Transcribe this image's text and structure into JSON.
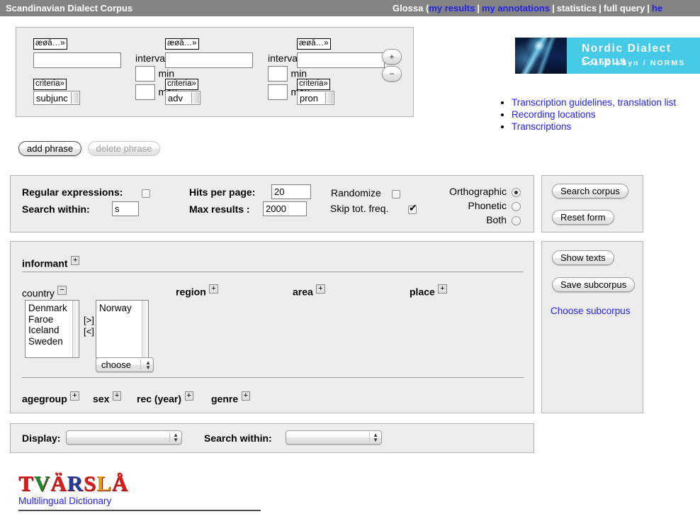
{
  "header": {
    "brand": "Scandinavian Dialect Corpus",
    "app_prefix": "Glossa (",
    "links": [
      {
        "label": "my results",
        "type": "link"
      },
      {
        "label": "my annotations",
        "type": "link"
      },
      {
        "label": "statistics",
        "type": "plain"
      },
      {
        "label": "full query",
        "type": "plain"
      },
      {
        "label": "he",
        "type": "link"
      }
    ],
    "separator": "|"
  },
  "query_builder": {
    "tokens": [
      {
        "special_chars_label": "æøå…»",
        "word_value": "",
        "criteria_label": "criteria»",
        "pos_value": "subjunc"
      },
      {
        "special_chars_label": "æøå…»",
        "word_value": "",
        "criteria_label": "criteria»",
        "pos_value": "adv"
      },
      {
        "special_chars_label": "æøå…»",
        "word_value": "",
        "criteria_label": "criteria»",
        "pos_value": "pron"
      }
    ],
    "intervals": [
      {
        "label": "interval:",
        "min_label": "min",
        "max_label": "max",
        "min_value": "",
        "max_value": ""
      },
      {
        "label": "interval:",
        "min_label": "min",
        "max_label": "max",
        "min_value": "",
        "max_value": ""
      }
    ],
    "add_token_label": "+",
    "remove_token_label": "−",
    "add_phrase_label": "add phrase",
    "delete_phrase_label": "delete phrase"
  },
  "options": {
    "regular_expressions_label": "Regular expressions:",
    "regular_expressions_checked": false,
    "search_within_label": "Search within:",
    "search_within_value": "s",
    "hits_per_page_label": "Hits per page:",
    "hits_per_page_value": "20",
    "max_results_label": "Max results :",
    "max_results_value": "2000",
    "randomize_label": "Randomize",
    "randomize_checked": false,
    "skip_freq_label": "Skip tot. freq.",
    "skip_freq_checked": true,
    "transcription_modes": [
      {
        "label": "Orthographic",
        "selected": true
      },
      {
        "label": "Phonetic",
        "selected": false
      },
      {
        "label": "Both",
        "selected": false
      }
    ]
  },
  "search_panel": {
    "search_corpus_label": "Search corpus",
    "reset_form_label": "Reset form"
  },
  "subcorpus_panel": {
    "show_texts_label": "Show texts",
    "save_subcorpus_label": "Save subcorpus",
    "choose_subcorpus_label": "Choose subcorpus"
  },
  "informant": {
    "title": "informant",
    "title_toggle": "+",
    "metadata_groups": [
      {
        "label": "country",
        "toggle": "−"
      },
      {
        "label": "region",
        "toggle": "+"
      },
      {
        "label": "area",
        "toggle": "+"
      },
      {
        "label": "place",
        "toggle": "+"
      }
    ],
    "country": {
      "available": [
        "Denmark",
        "Faroe",
        "Iceland",
        "Sweden"
      ],
      "selected": [
        "Norway"
      ],
      "move_right_label": "[>]",
      "move_left_label": "[<]",
      "choose_label": "choose"
    },
    "bottom_groups": [
      {
        "label": "agegroup",
        "toggle": "+"
      },
      {
        "label": "sex",
        "toggle": "+"
      },
      {
        "label": "rec (year)",
        "toggle": "+"
      },
      {
        "label": "genre",
        "toggle": "+"
      }
    ]
  },
  "display_panel": {
    "display_label": "Display:",
    "display_value": "",
    "search_within_label": "Search within:",
    "search_within_value": ""
  },
  "nordic_logo": {
    "line1": "Nordic  Dialect  Corpus",
    "line2": "ScanDiaSyn / NORMS"
  },
  "bullet_links": [
    "Transcription guidelines, translation list",
    "Recording locations",
    "Transcriptions"
  ],
  "tvarsla": {
    "letters": [
      "T",
      "V",
      "Ä",
      "R",
      "S",
      "L",
      "Å"
    ],
    "subtitle": "Multilingual Dictionary"
  },
  "colors": {
    "header_bg": "#848484",
    "link_blue": "#2222ee",
    "panel_bg": "#ededed",
    "logo_cyan": "#45cbe8"
  }
}
